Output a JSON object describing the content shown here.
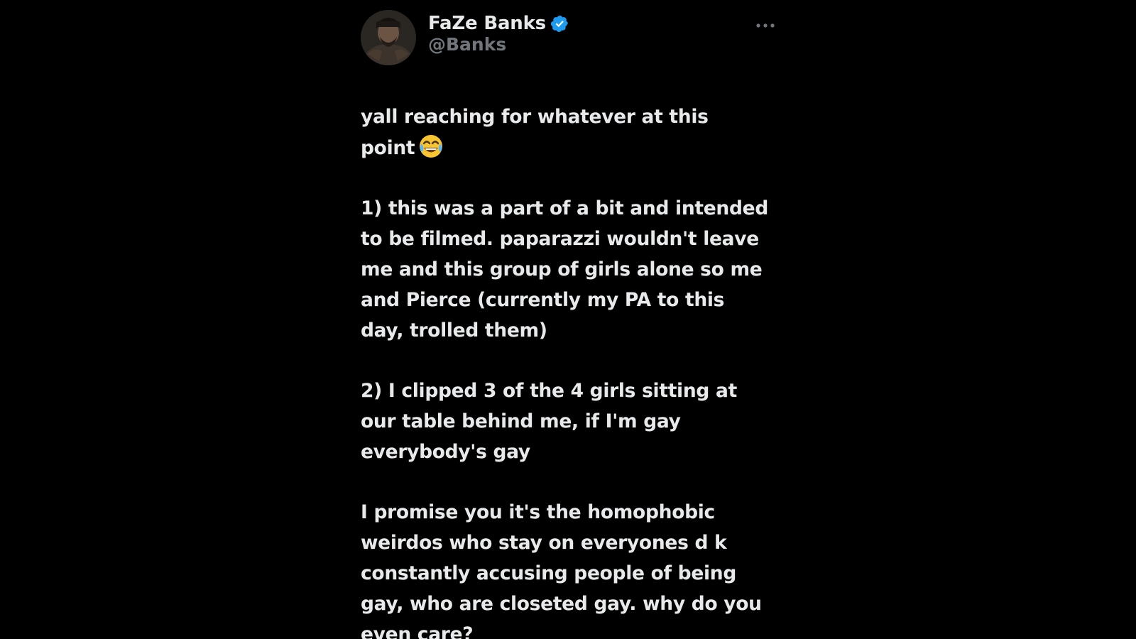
{
  "tweet": {
    "author": {
      "display_name": "FaZe Banks",
      "handle": "@Banks",
      "verified": true,
      "verified_color": "#1d9bf0"
    },
    "more_icon": "more-horizontal-icon",
    "paragraphs": [
      {
        "lines": [
          "yall reaching for whatever at this",
          "point"
        ],
        "trailing_emoji": "face-with-tears-of-joy"
      },
      {
        "lines": [
          "1) this was a part of a bit and intended",
          "to be filmed. paparazzi wouldn't leave",
          "me and this group of girls alone so me",
          "and Pierce (currently my PA to this",
          "day, trolled them)"
        ]
      },
      {
        "lines": [
          "2) I clipped 3 of the 4 girls sitting at",
          "our table behind me, if I'm gay",
          "everybody's gay"
        ]
      },
      {
        "lines": [
          "I promise you it's the homophobic",
          "weirdos who stay on everyones d  k",
          "constantly accusing people of being",
          "gay, who are closeted gay. why do you",
          "even care?"
        ]
      }
    ]
  },
  "colors": {
    "background": "#000000",
    "text_primary": "#e7e9ea",
    "text_secondary": "#71767b"
  }
}
